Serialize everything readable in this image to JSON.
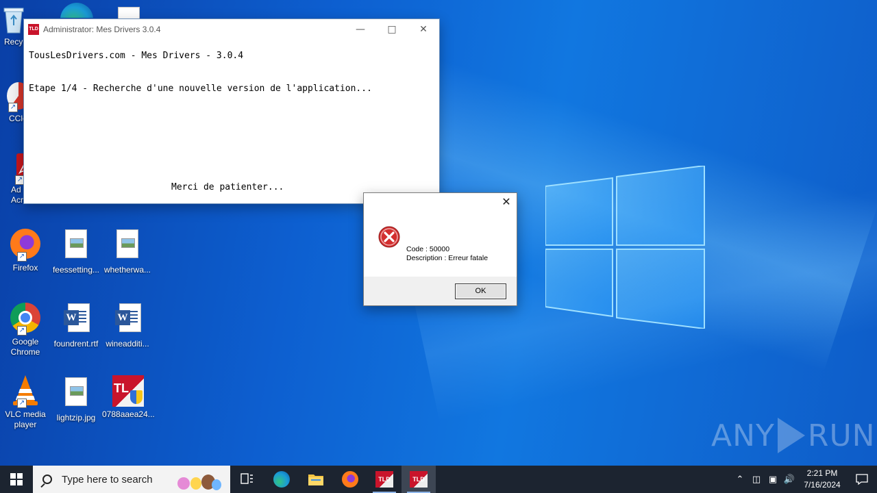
{
  "desktop": {
    "icons": [
      {
        "label": "Recy",
        "icon": "recycle-bin-icon"
      },
      {
        "label": "CCle",
        "icon": "ccleaner-icon"
      },
      {
        "label": "Ad\nAcrobat",
        "icon": "acrobat-icon"
      },
      {
        "label": "Firefox",
        "icon": "firefox-icon"
      },
      {
        "label": "feessetting...",
        "icon": "image-file-icon"
      },
      {
        "label": "whetherwa...",
        "icon": "image-file-icon"
      },
      {
        "label": "Google Chrome",
        "icon": "chrome-icon"
      },
      {
        "label": "foundrent.rtf",
        "icon": "word-doc-icon"
      },
      {
        "label": "wineadditi...",
        "icon": "word-doc-icon"
      },
      {
        "label": "VLC media player",
        "icon": "vlc-icon"
      },
      {
        "label": "lightzip.jpg",
        "icon": "image-file-icon"
      },
      {
        "label": "0788aaea24...",
        "icon": "tld-app-icon"
      }
    ]
  },
  "console": {
    "title": "Administrator:  Mes Drivers 3.0.4",
    "icon_text": "TLD",
    "line1": "TousLesDrivers.com - Mes Drivers - 3.0.4",
    "line2": "Etape 1/4 - Recherche d'une nouvelle version de l'application...",
    "line3": "Merci de patienter..."
  },
  "dialog": {
    "code": "Code : 50000",
    "description": "Description : Erreur fatale",
    "ok_label": "OK"
  },
  "watermark": {
    "left": "ANY",
    "right": "RUN"
  },
  "taskbar": {
    "search_placeholder": "Type here to search",
    "time": "2:21 PM",
    "date": "7/16/2024",
    "tld_label": "TLD"
  },
  "colors": {
    "tld_red": "#c9142b",
    "error_red": "#d32f2f",
    "taskbar": "#1c2430"
  }
}
